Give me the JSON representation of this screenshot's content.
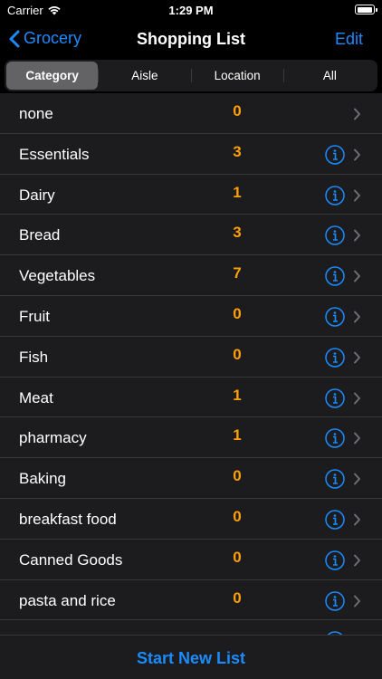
{
  "status": {
    "carrier": "Carrier",
    "time": "1:29 PM",
    "battery_level": 1.0
  },
  "nav": {
    "back_label": "Grocery",
    "title": "Shopping List",
    "edit_label": "Edit"
  },
  "segments": [
    "Category",
    "Aisle",
    "Location",
    "All"
  ],
  "selected_segment": "Category",
  "rows": [
    {
      "name": "none",
      "count": "0",
      "has_info": false
    },
    {
      "name": "Essentials",
      "count": "3",
      "has_info": true
    },
    {
      "name": "Dairy",
      "count": "1",
      "has_info": true
    },
    {
      "name": "Bread",
      "count": "3",
      "has_info": true
    },
    {
      "name": "Vegetables",
      "count": "7",
      "has_info": true
    },
    {
      "name": "Fruit",
      "count": "0",
      "has_info": true
    },
    {
      "name": "Fish",
      "count": "0",
      "has_info": true
    },
    {
      "name": "Meat",
      "count": "1",
      "has_info": true
    },
    {
      "name": "pharmacy",
      "count": "1",
      "has_info": true
    },
    {
      "name": "Baking",
      "count": "0",
      "has_info": true
    },
    {
      "name": "breakfast food",
      "count": "0",
      "has_info": true
    },
    {
      "name": "Canned Goods",
      "count": "0",
      "has_info": true
    },
    {
      "name": "pasta and rice",
      "count": "0",
      "has_info": true
    },
    {
      "name": "",
      "count": "",
      "has_info": true
    }
  ],
  "bottom": {
    "start_label": "Start New List"
  },
  "colors": {
    "accent": "#1a8cff",
    "count": "#ff9f0a",
    "background": "#000000",
    "cell": "#1c1c1e"
  },
  "icons": {
    "back": "chevron-left-icon",
    "info": "info-circle-icon",
    "disclosure": "chevron-right-icon",
    "wifi": "wifi-icon",
    "battery": "battery-icon"
  }
}
